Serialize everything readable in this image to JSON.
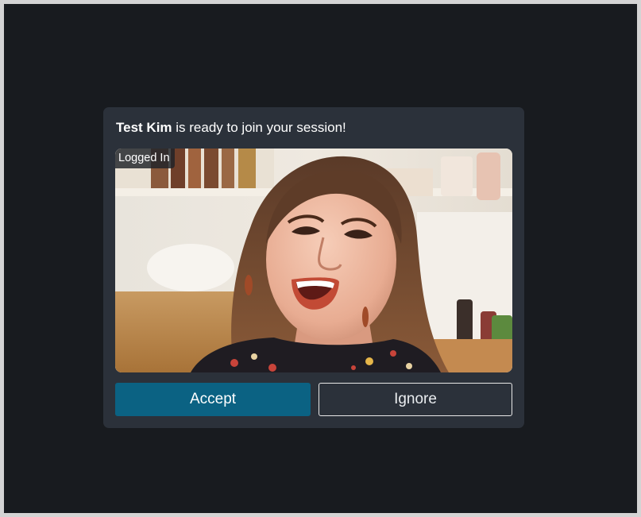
{
  "notification": {
    "user_name": "Test Kim",
    "message_suffix": " is ready to join your session!"
  },
  "video": {
    "status_tag": "Logged In",
    "description_icon": "participant-video-preview"
  },
  "actions": {
    "accept_label": "Accept",
    "ignore_label": "Ignore"
  },
  "colors": {
    "page_background": "#181b1f",
    "dialog_background": "#2b313a",
    "accept_button": "#0b6283",
    "ignore_border": "#e8e8e8"
  }
}
